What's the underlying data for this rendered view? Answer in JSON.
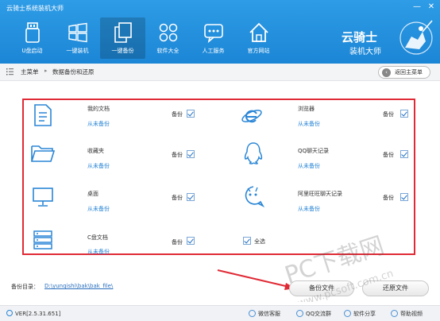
{
  "window": {
    "title": "云骑士系统装机大师",
    "min": "—",
    "close": "✕"
  },
  "nav": [
    {
      "label": "U盘启动",
      "icon": "usb-drive-icon",
      "active": false
    },
    {
      "label": "一键装机",
      "icon": "windows-icon",
      "active": false
    },
    {
      "label": "一键备份",
      "icon": "backup-copy-icon",
      "active": true
    },
    {
      "label": "软件大全",
      "icon": "apps-grid-icon",
      "active": false
    },
    {
      "label": "人工服务",
      "icon": "support-chat-icon",
      "active": false
    },
    {
      "label": "官方网站",
      "icon": "home-icon",
      "active": false
    }
  ],
  "logo": {
    "line1": "云骑士",
    "line2": "装机大师"
  },
  "breadcrumb": {
    "home": "主菜单",
    "current": "数据备份和还原",
    "back": "返回主菜单"
  },
  "items": [
    {
      "name": "我的文档",
      "status": "从未备份",
      "backup_label": "备份",
      "icon": "document-icon",
      "checked": true
    },
    {
      "name": "浏览器",
      "status": "从未备份",
      "backup_label": "备份",
      "icon": "ie-browser-icon",
      "checked": true
    },
    {
      "name": "收藏夹",
      "status": "从未备份",
      "backup_label": "备份",
      "icon": "folder-icon",
      "checked": true
    },
    {
      "name": "QQ聊天记录",
      "status": "从未备份",
      "backup_label": "备份",
      "icon": "qq-penguin-icon",
      "checked": true
    },
    {
      "name": "桌面",
      "status": "从未备份",
      "backup_label": "备份",
      "icon": "monitor-icon",
      "checked": true
    },
    {
      "name": "阿里旺旺聊天记录",
      "status": "从未备份",
      "backup_label": "备份",
      "icon": "aliwangwang-icon",
      "checked": true
    },
    {
      "name": "C盘文档",
      "status": "从未备份",
      "backup_label": "备份",
      "icon": "server-drive-icon",
      "checked": true
    }
  ],
  "select_all": {
    "label": "全选",
    "checked": true
  },
  "backup_dir": {
    "label": "备份目录：",
    "path": "D:\\yunqishi\\bak\\bak_file\\"
  },
  "actions": {
    "backup": "备份文件",
    "restore": "还原文件"
  },
  "status": {
    "version": "VER[2.5.31.651]",
    "links": [
      "微信客服",
      "QQ交流群",
      "软件分享",
      "帮助视频"
    ]
  },
  "watermark": {
    "text1": "PC下载网",
    "text2": "www.pcsoft.com.cn"
  },
  "colors": {
    "titlebar": "#1e8ad8",
    "accent": "#2a86d6",
    "highlight_border": "#e02a35"
  }
}
